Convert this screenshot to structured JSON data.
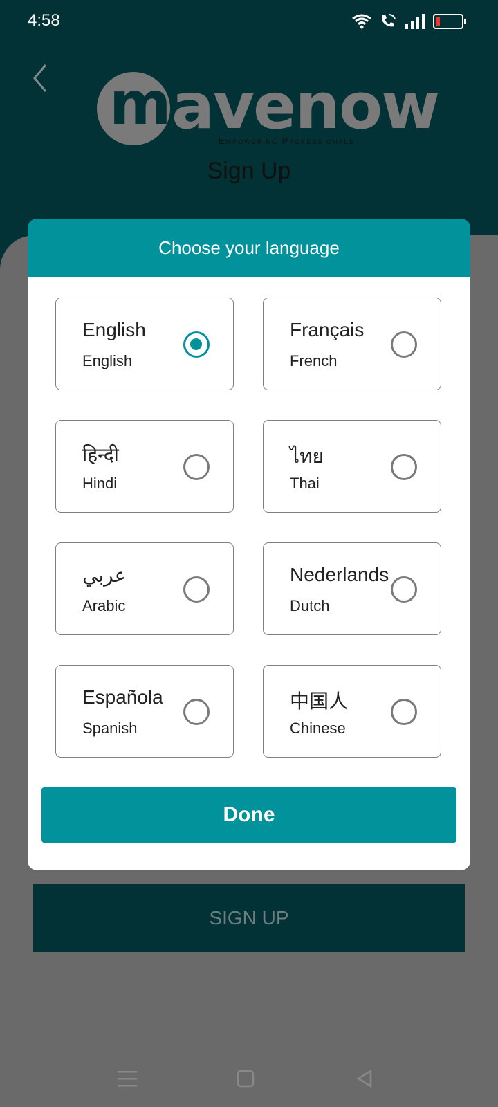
{
  "status": {
    "time": "4:58"
  },
  "header": {
    "logo_text": "mavenow",
    "logo_m": "m",
    "logo_rest": "avenow",
    "tagline": "Empowering Professionals",
    "title": "Sign Up"
  },
  "dialog": {
    "title": "Choose your language",
    "options": [
      {
        "native": "English",
        "english": "English",
        "selected": true
      },
      {
        "native": "Français",
        "english": "French",
        "selected": false
      },
      {
        "native": "हिन्दी",
        "english": "Hindi",
        "selected": false
      },
      {
        "native": "ไทย",
        "english": "Thai",
        "selected": false
      },
      {
        "native": "عربي",
        "english": "Arabic",
        "selected": false
      },
      {
        "native": "Nederlands",
        "english": "Dutch",
        "selected": false
      },
      {
        "native": "Española",
        "english": "Spanish",
        "selected": false
      },
      {
        "native": "中国人",
        "english": "Chinese",
        "selected": false
      }
    ],
    "done_label": "Done"
  },
  "background_button": {
    "label": "SIGN UP"
  },
  "colors": {
    "header": "#023236",
    "accent": "#02929c",
    "battery_low": "#e53935"
  }
}
